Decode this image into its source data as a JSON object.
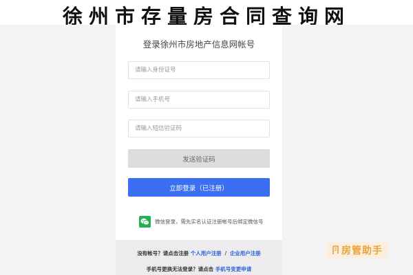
{
  "banner": {
    "title": "徐州市存量房合同查询网"
  },
  "login": {
    "title": "登录徐州市房地产信息网帐号",
    "id_placeholder": "请输入身份证号",
    "phone_placeholder": "请输入手机号",
    "sms_placeholder": "请输入短信验证码",
    "send_code_label": "发送验证码",
    "login_label": "立即登录（已注册）",
    "wechat_text": "微信登录，需先实名认证注册帐号后绑定微信号"
  },
  "footer": {
    "no_account_text": "没有帐号？请点击注册",
    "personal_register": "个人用户注册",
    "separator": "/",
    "company_register": "企业用户注册",
    "phone_changed_text": "手机号更换无法登录？请点击",
    "phone_change_link": "手机号变更申请"
  },
  "watermark": {
    "text": "房管助手"
  },
  "colors": {
    "primary": "#3a6ff2",
    "disabled": "#dcdcdc",
    "wechat": "#22b14c",
    "link": "#2f63d6",
    "watermark": "#e8a43a"
  },
  "icons": {
    "wechat": "wechat-icon",
    "watermark": "house-icon"
  }
}
